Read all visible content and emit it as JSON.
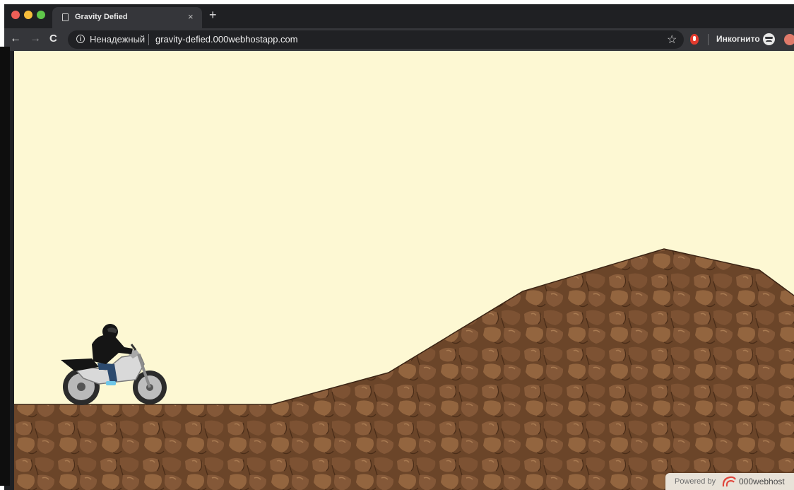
{
  "browser": {
    "tab_title": "Gravity Defied",
    "tab_close": "×",
    "new_tab": "+",
    "security_label": "Ненадежный",
    "url": "gravity-defied.000webhostapp.com",
    "incognito_label": "Инкогнито",
    "icons": [
      "back-icon",
      "forward-icon",
      "reload-icon",
      "info-icon",
      "star-icon",
      "extension-icon",
      "incognito-icon",
      "profile-icon"
    ]
  },
  "game": {
    "sky_color": "#fdf8d3",
    "ground_color": "#6b4529",
    "rider_color": "#151515",
    "jeans_color": "#2c4a6e",
    "motorcycle_color": "#d9d9d9"
  },
  "footer": {
    "powered_label": "Powered by",
    "brand": "000webhost",
    "logo_color": "#e0443a"
  }
}
